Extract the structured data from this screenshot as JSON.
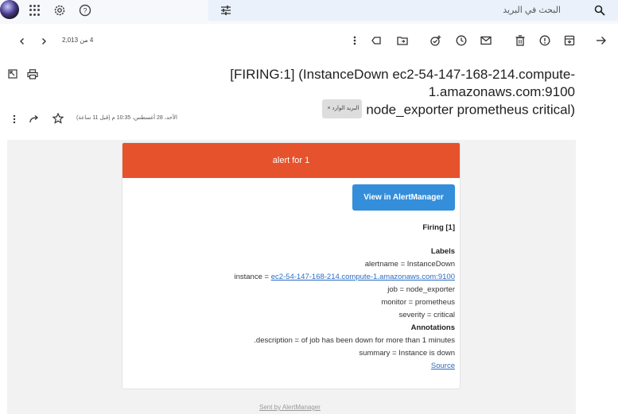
{
  "topbar": {
    "search_placeholder": "البحث في البريد",
    "icons": [
      "avatar",
      "apps-icon",
      "gear-icon",
      "help-icon",
      "tune-icon",
      "search-icon"
    ]
  },
  "toolbar": {
    "pager_text": "4 من 2,013",
    "icons": [
      "back-arrow-icon",
      "archive-icon",
      "report-spam-icon",
      "delete-icon",
      "mark-unread-icon",
      "snooze-icon",
      "add-task-icon",
      "move-to-icon",
      "label-icon",
      "more-icon",
      "next-icon",
      "prev-icon"
    ]
  },
  "email": {
    "subject_line1": "[FIRING:1] (InstanceDown ec2-54-147-168-214.compute-1.amazonaws.com:9100",
    "subject_line2": "node_exporter prometheus critical)",
    "inbox_chip": "البريد الوارد",
    "chip_close": "×",
    "date_text": "الأحد، 28 أغسطس، 10:35 م (قبل 11 ساعة)"
  },
  "alert": {
    "header": "alert for 1",
    "button": "View in AlertManager",
    "firing": "Firing [1]",
    "labels_heading": "Labels",
    "alertname": "alertname = InstanceDown",
    "instance_prefix": "instance = ",
    "instance_link": "ec2-54-147-168-214.compute-1.amazonaws.com:9100",
    "job": "job = node_exporter",
    "monitor": "monitor = prometheus",
    "severity": "severity = critical",
    "annotations_heading": "Annotations",
    "description": ".description = of job has been down for more than 1 minutes",
    "summary": "summary = Instance is down",
    "source": "Source",
    "sent_by": "Sent by AlertManager"
  },
  "colors": {
    "header_red": "#e6522c",
    "button_blue": "#348eda",
    "link_blue": "#2a6cc4"
  }
}
